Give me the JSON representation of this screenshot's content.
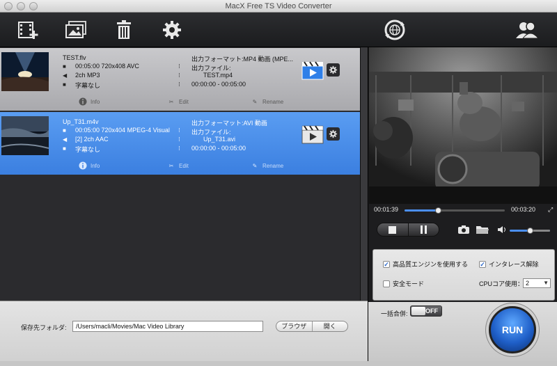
{
  "window": {
    "title": "MacX Free TS Video Converter"
  },
  "toolbar": {
    "icons": [
      "add-video-icon",
      "add-photo-icon",
      "trash-icon",
      "settings-gear-icon",
      "update-globe-icon",
      "users-icon"
    ]
  },
  "files": [
    {
      "name": "TEST.flv",
      "video": "00:05:00 720x408 AVC",
      "audio": "2ch MP3",
      "subtitle": "字幕なし",
      "format": "出力フォーマット:MP4 動画 (MPE...",
      "output_label": "出力ファイル:",
      "output_file": "TEST.mp4",
      "range": "00:00:00 - 00:05:00",
      "selected": false
    },
    {
      "name": "Up_T31.m4v",
      "video": "00:05:00 720x404 MPEG-4 Visual",
      "audio": "[2] 2ch AAC",
      "subtitle": "字幕なし",
      "format": "出力フォーマット:AVI 動画",
      "output_label": "出力ファイル:",
      "output_file": "Up_T31.avi",
      "range": "00:00:00 - 00:05:00",
      "selected": true
    }
  ],
  "actions": {
    "info": "Info",
    "edit": "Edit",
    "rename": "Rename"
  },
  "save": {
    "label": "保存先フォルダ:",
    "path": "/Users/macli/Movies/Mac Video Library",
    "browse": "ブラウザ",
    "open": "開く"
  },
  "player": {
    "current_time": "00:01:39",
    "total_time": "00:03:20",
    "progress": 0.33,
    "volume": 0.5
  },
  "options": {
    "hq_engine": "高品質エンジンを使用する",
    "hq_engine_checked": true,
    "deinterlace": "インタレース解除",
    "deinterlace_checked": true,
    "safe_mode": "安全モード",
    "safe_mode_checked": false,
    "cpu_label": "CPUコア使用：",
    "cpu_value": "2"
  },
  "merge": {
    "label": "一括合併:",
    "state": "OFF"
  },
  "run": {
    "label": "RUN"
  }
}
